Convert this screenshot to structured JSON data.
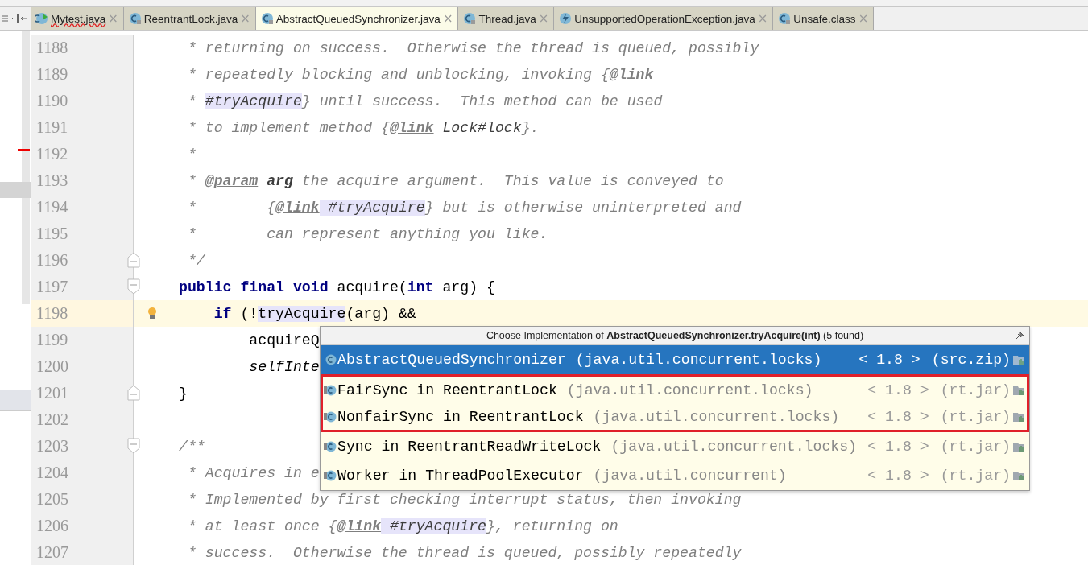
{
  "tabs": [
    {
      "label": "Mytest.java",
      "kind": "run",
      "selected": false,
      "error": true,
      "close": "×"
    },
    {
      "label": "ReentrantLock.java",
      "kind": "class-locked",
      "selected": false,
      "error": false,
      "close": "×"
    },
    {
      "label": "AbstractQueuedSynchronizer.java",
      "kind": "class-locked",
      "selected": true,
      "error": false,
      "close": "×"
    },
    {
      "label": "Thread.java",
      "kind": "class-locked",
      "selected": false,
      "error": false,
      "close": "×"
    },
    {
      "label": "UnsupportedOperationException.java",
      "kind": "exception",
      "selected": false,
      "error": false,
      "close": "×"
    },
    {
      "label": "Unsafe.class",
      "kind": "class-locked",
      "selected": false,
      "error": false,
      "close": "×"
    }
  ],
  "editor": {
    "lines": [
      {
        "number": "1188",
        "current": false,
        "segments": [
          {
            "kind": "comment",
            "text": " * returning on success.  Otherwise the thread is queued, possibly"
          }
        ]
      },
      {
        "number": "1189",
        "current": false,
        "segments": [
          {
            "kind": "comment",
            "text": " * repeatedly blocking and unblocking, invoking {"
          },
          {
            "kind": "tag",
            "text": "@link"
          }
        ]
      },
      {
        "number": "1190",
        "current": false,
        "segments": [
          {
            "kind": "comment",
            "text": " * "
          },
          {
            "kind": "ref-highlight",
            "text": "#tryAcquire"
          },
          {
            "kind": "comment",
            "text": "} until success.  This method can be used"
          }
        ]
      },
      {
        "number": "1191",
        "current": false,
        "segments": [
          {
            "kind": "comment",
            "text": " * to implement method {"
          },
          {
            "kind": "tag",
            "text": "@link"
          },
          {
            "kind": "ref",
            "text": " Lock#lock"
          },
          {
            "kind": "comment",
            "text": "}."
          }
        ]
      },
      {
        "number": "1192",
        "current": false,
        "segments": [
          {
            "kind": "comment",
            "text": " *"
          }
        ]
      },
      {
        "number": "1193",
        "current": false,
        "segments": [
          {
            "kind": "comment",
            "text": " * "
          },
          {
            "kind": "tag",
            "text": "@param"
          },
          {
            "kind": "param",
            "text": " arg"
          },
          {
            "kind": "comment",
            "text": " the acquire argument.  This value is conveyed to"
          }
        ]
      },
      {
        "number": "1194",
        "current": false,
        "segments": [
          {
            "kind": "comment",
            "text": " *        {"
          },
          {
            "kind": "tag",
            "text": "@link"
          },
          {
            "kind": "ref-highlight",
            "text": " #tryAcquire"
          },
          {
            "kind": "comment",
            "text": "} but is otherwise uninterpreted and"
          }
        ]
      },
      {
        "number": "1195",
        "current": false,
        "segments": [
          {
            "kind": "comment",
            "text": " *        can represent anything you like."
          }
        ]
      },
      {
        "number": "1196",
        "current": false,
        "fold_end": true,
        "segments": [
          {
            "kind": "comment",
            "text": " */"
          }
        ]
      },
      {
        "number": "1197",
        "current": false,
        "fold_start": true,
        "segments": [
          {
            "kind": "keyword",
            "text": "public final void"
          },
          {
            "kind": "plain",
            "text": " acquire("
          },
          {
            "kind": "keyword",
            "text": "int"
          },
          {
            "kind": "plain",
            "text": " arg) {"
          }
        ]
      },
      {
        "number": "1198",
        "current": true,
        "bulb": true,
        "segments": [
          {
            "kind": "keyword",
            "text": "    if"
          },
          {
            "kind": "plain",
            "text": " (!"
          },
          {
            "kind": "call-highlight",
            "text": "tryAcquire"
          },
          {
            "kind": "plain",
            "text": "(arg) &&"
          }
        ]
      },
      {
        "number": "1199",
        "current": false,
        "segments": [
          {
            "kind": "plain",
            "text": "        acquireQ"
          }
        ]
      },
      {
        "number": "1200",
        "current": false,
        "segments": [
          {
            "kind": "static",
            "text": "        selfInte"
          }
        ]
      },
      {
        "number": "1201",
        "current": false,
        "fold_end": true,
        "segments": [
          {
            "kind": "plain",
            "text": "}"
          }
        ]
      },
      {
        "number": "1202",
        "current": false
      },
      {
        "number": "1203",
        "current": false,
        "fold_start": true,
        "segments": [
          {
            "kind": "comment",
            "text": "/**"
          }
        ]
      },
      {
        "number": "1204",
        "current": false,
        "segments": [
          {
            "kind": "comment",
            "text": " * Acquires in e"
          }
        ]
      },
      {
        "number": "1205",
        "current": false,
        "segments": [
          {
            "kind": "comment",
            "text": " * Implemented by first checking interrupt status, then invoking"
          }
        ]
      },
      {
        "number": "1206",
        "current": false,
        "segments": [
          {
            "kind": "comment",
            "text": " * at least once {"
          },
          {
            "kind": "tag",
            "text": "@link"
          },
          {
            "kind": "ref-highlight",
            "text": " #tryAcquire"
          },
          {
            "kind": "comment",
            "text": "}, returning on"
          }
        ]
      },
      {
        "number": "1207",
        "current": false,
        "segments": [
          {
            "kind": "comment",
            "text": " * success.  Otherwise the thread is queued, possibly repeatedly"
          }
        ]
      }
    ]
  },
  "popup": {
    "title": "Choose Implementation of **AbstractQueuedSynchronizer.tryAcquire(int)** (5 found)",
    "items": [
      {
        "name": "AbstractQueuedSynchronizer",
        "package": "(java.util.concurrent.locks)",
        "version": "< 1.8 >",
        "source": "(src.zip)",
        "selected": true,
        "boxed": false
      },
      {
        "name": "FairSync in ReentrantLock",
        "package": "(java.util.concurrent.locks)",
        "version": "< 1.8 >",
        "source": "(rt.jar)",
        "selected": false,
        "boxed": true
      },
      {
        "name": "NonfairSync in ReentrantLock",
        "package": "(java.util.concurrent.locks)",
        "version": "< 1.8 >",
        "source": "(rt.jar)",
        "selected": false,
        "boxed": true
      },
      {
        "name": "Sync in ReentrantReadWriteLock",
        "package": "(java.util.concurrent.locks)",
        "version": "< 1.8 >",
        "source": "(rt.jar)",
        "selected": false,
        "boxed": false
      },
      {
        "name": "Worker in ThreadPoolExecutor",
        "package": "(java.util.concurrent)",
        "version": "< 1.8 >",
        "source": "(rt.jar)",
        "selected": false,
        "boxed": false
      }
    ]
  }
}
